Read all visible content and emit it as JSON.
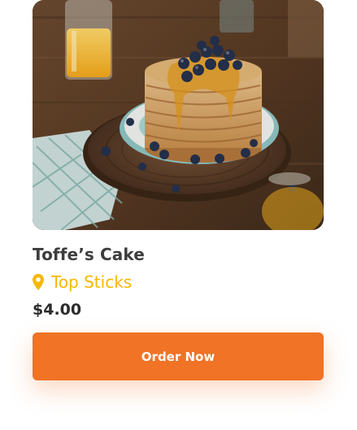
{
  "product": {
    "name": "Toffe’s Cake",
    "location": "Top Sticks",
    "price": "$4.00",
    "order_label": "Order Now",
    "image_subject": "stack of pancakes with blueberries and syrup"
  },
  "icons": {
    "location": "map-pin-icon"
  },
  "colors": {
    "accent": "#f07326",
    "location": "#f5b800",
    "title": "#3d3d3d",
    "price": "#2b2b2b"
  }
}
